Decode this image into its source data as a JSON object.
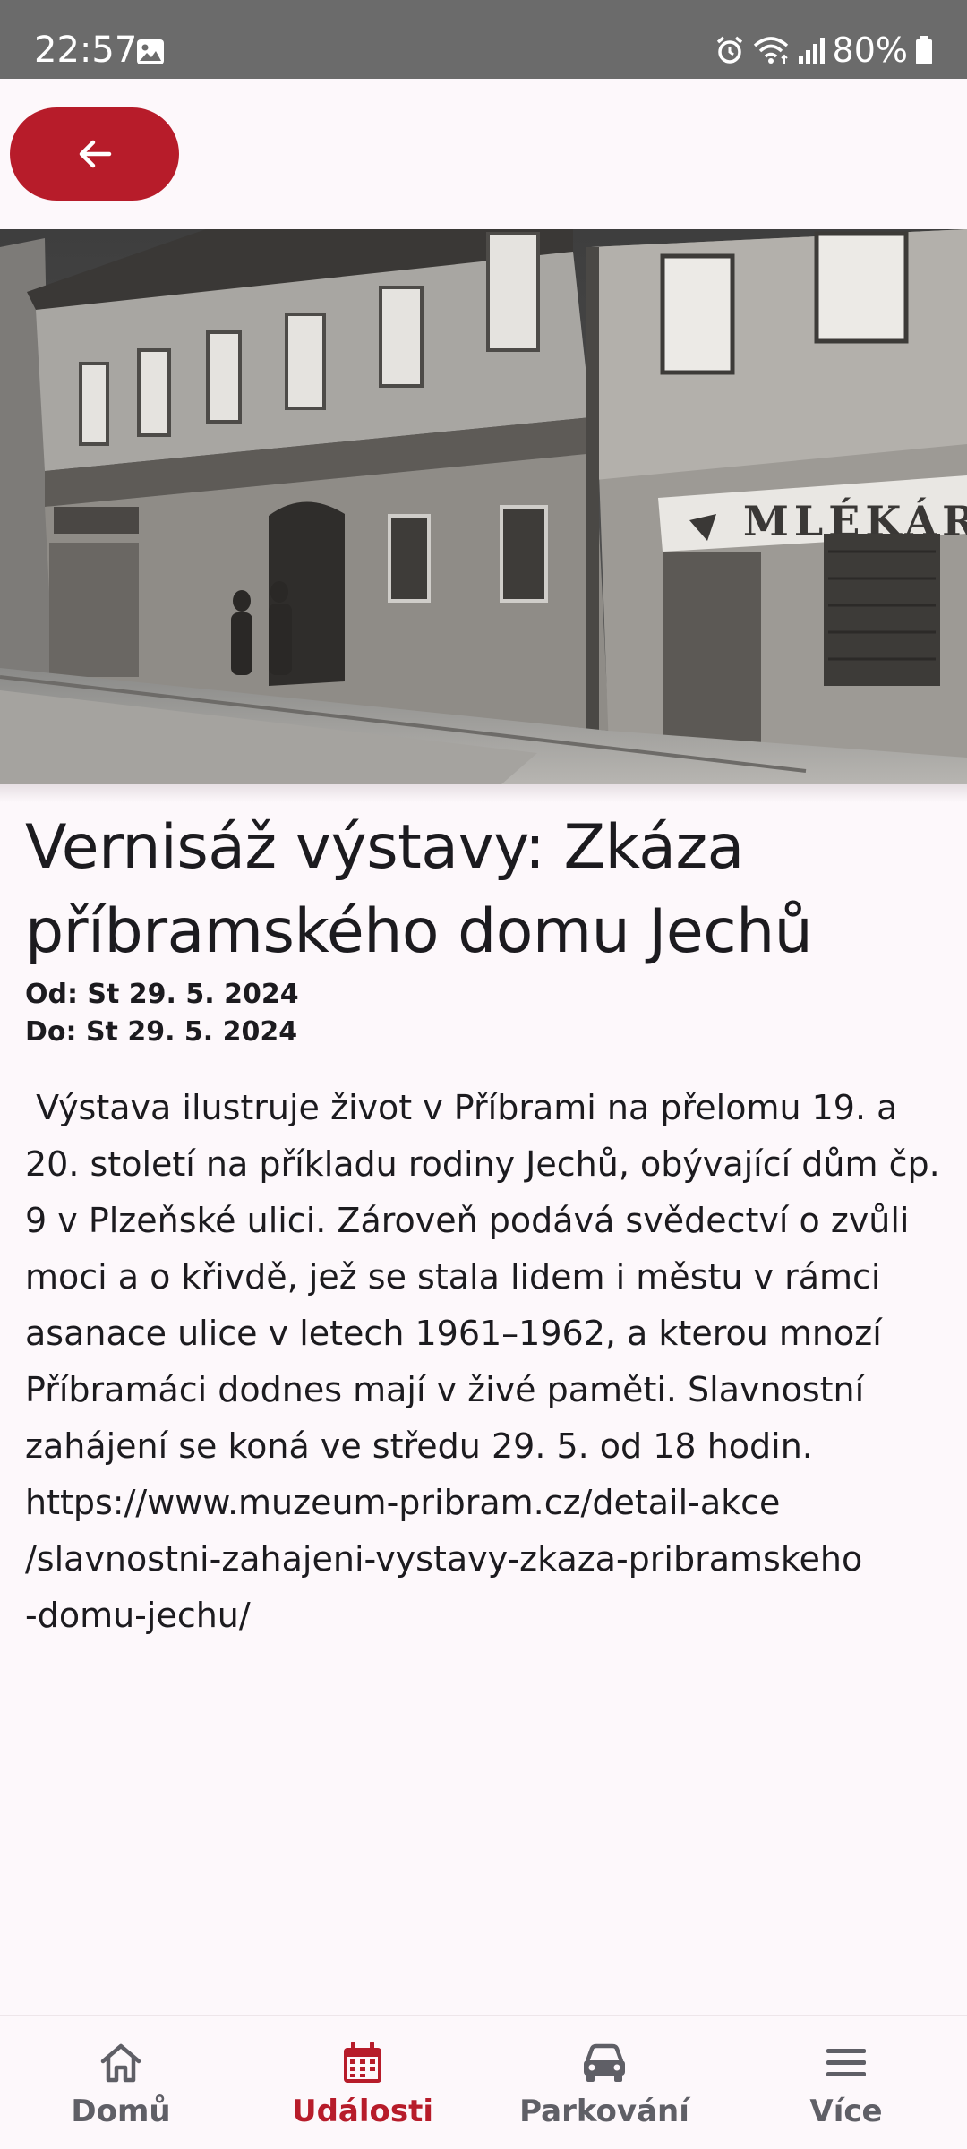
{
  "status_bar": {
    "time": "22:57",
    "battery": "80%",
    "icons": [
      "gallery-icon",
      "alarm-icon",
      "wifi-icon",
      "signal-icon",
      "battery-icon"
    ]
  },
  "top_bar": {
    "back_icon": "arrow-left-icon"
  },
  "hero_image": {
    "sign_text": "MLÉKÁR"
  },
  "event": {
    "title": "Vernisáž výstavy: Zkáza příbramského domu Jechů",
    "from": "Od: St 29. 5. 2024",
    "to": "Do: St 29. 5. 2024",
    "description": " Výstava ilustruje život v Příbrami na přelomu 19. a 20. století na příkladu rodiny Jechů, obývající dům čp. 9 v Plzeňské ulici. Zároveň podává svědectví o zvůli moci a o křivdě, jež se stala lidem i městu v rámci asanace ulice v letech 1961–1962, a kterou mnozí Příbramáci dodnes mají v živé paměti. Slavnostní zahájení se koná ve středu 29. 5. od 18 hodin. https://www.muzeum-pribram.cz/detail-akce\n/slavnostni-zahajeni-vystavy-zkaza-pribramskeho\n-domu-jechu/"
  },
  "bottom_nav": {
    "items": [
      {
        "label": "Domů",
        "icon": "home-icon",
        "active": false
      },
      {
        "label": "Události",
        "icon": "calendar-icon",
        "active": true
      },
      {
        "label": "Parkování",
        "icon": "car-icon",
        "active": false
      },
      {
        "label": "Více",
        "icon": "menu-icon",
        "active": false
      }
    ]
  },
  "colors": {
    "accent": "#b71c2a",
    "background": "#fdf8fb",
    "text": "#1c1b1f",
    "nav_inactive": "#5f5f66",
    "status_bar": "#6b6b6b"
  }
}
